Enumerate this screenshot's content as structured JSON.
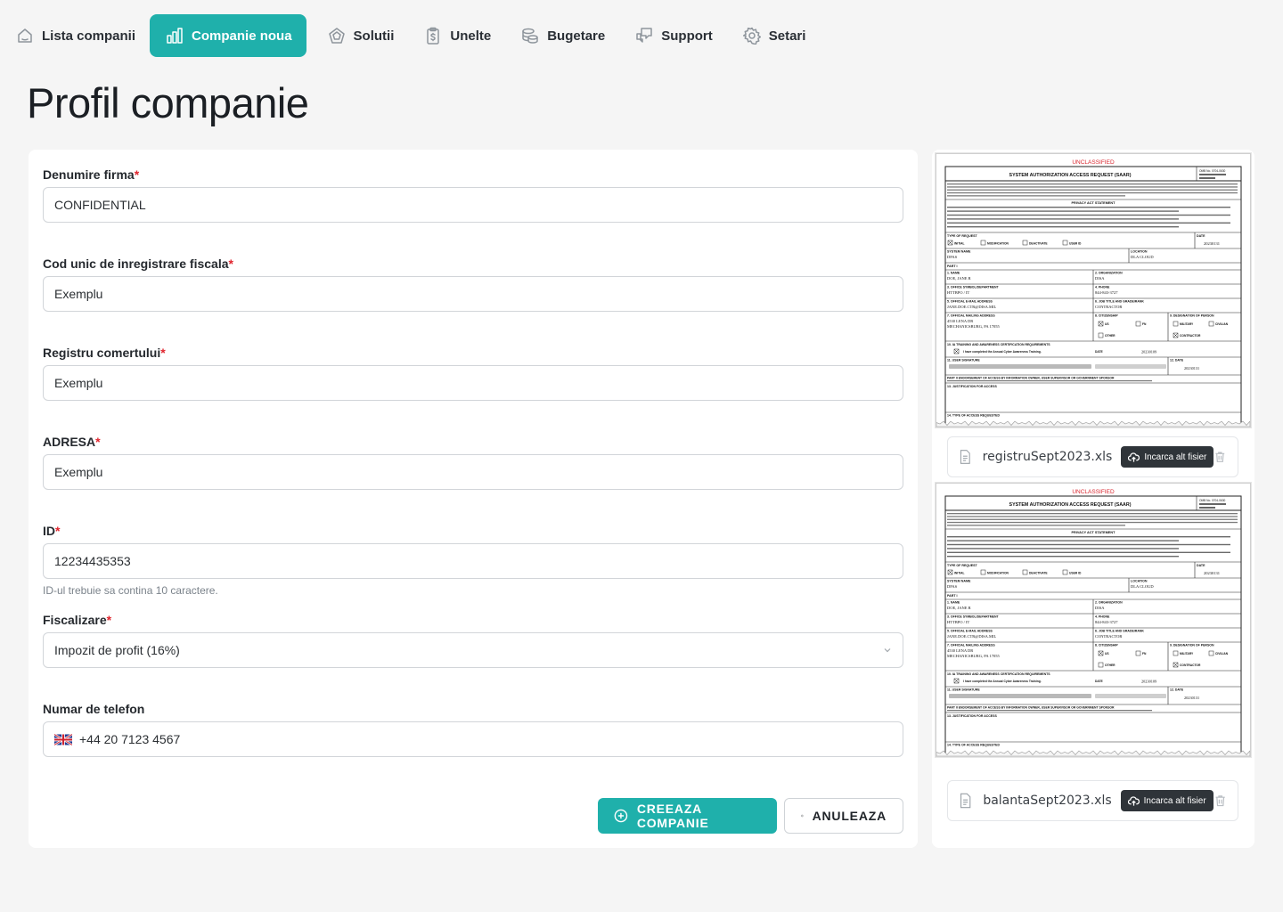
{
  "nav": {
    "items": [
      {
        "label": "Lista companii",
        "icon": "home-icon"
      },
      {
        "label": "Companie noua",
        "icon": "chart-bars-icon",
        "active": true
      },
      {
        "label": "Solutii",
        "icon": "pentagon-icon"
      },
      {
        "label": "Unelte",
        "icon": "clipboard-dollar-icon"
      },
      {
        "label": "Bugetare",
        "icon": "coins-icon"
      },
      {
        "label": "Support",
        "icon": "chat-bubbles-icon"
      },
      {
        "label": "Setari",
        "icon": "gear-icon"
      }
    ]
  },
  "page": {
    "title": "Profil companie"
  },
  "form": {
    "company_name": {
      "label": "Denumire firma",
      "value": "CONFIDENTIAL"
    },
    "fiscal_code": {
      "label": "Cod unic de inregistrare fiscala",
      "value": "Exemplu"
    },
    "trade_register": {
      "label": "Registru comertului",
      "value": "Exemplu"
    },
    "address": {
      "label": "ADRESA",
      "value": "Exemplu"
    },
    "id": {
      "label": "ID",
      "value": "12234435353",
      "hint": "ID-ul trebuie sa contina 10 caractere."
    },
    "taxation": {
      "label": "Fiscalizare",
      "value": "Impozit de profit (16%)"
    },
    "phone": {
      "label": "Numar de telefon",
      "value": "+44 20 7123 4567",
      "flag": "uk-flag-icon"
    },
    "required_mark": "*",
    "create_label": "CREEAZA COMPANIE",
    "cancel_label": "ANULEAZA"
  },
  "documents": [
    {
      "file_name": "registruSept2023.xls",
      "upload_label": "Incarca alt fisier",
      "preview": {
        "banner": "UNCLASSIFIED",
        "title": "SYSTEM AUTHORIZATION ACCESS REQUEST (SAAR)",
        "omb": "OMB No. 0704-0630",
        "privacy": "PRIVACY ACT STATEMENT",
        "type_of_request": "TYPE OF REQUEST",
        "date_label": "DATE",
        "initial": "INITIAL",
        "modification": "MODIFICATION",
        "deactivate": "DEACTIVATE",
        "user_id": "USER ID",
        "date_value": "20230131",
        "system_name": "SYSTEM NAME",
        "system_value": "DPAS",
        "location": "LOCATION",
        "location_value": "DLA CLOUD",
        "part1": "PART I",
        "name_label": "1. NAME",
        "name_value": "DOE, JANE R",
        "org_label": "2. ORGANIZATION",
        "org_value": "DISA",
        "office_label": "3. OFFICE SYMBOL/DEPARTMENT",
        "office_value": "HTTBPO / IT",
        "phone_label": "4. PHONE",
        "phone_value": "844-843-3727",
        "email_label": "5. OFFICIAL E-MAIL ADDRESS",
        "email_value": "JANE.DOE.CTR@DISA.MIL",
        "job_label": "6. JOB TITLE AND GRADE/RANK",
        "job_value": "CONTRACTOR",
        "mail_label": "7. OFFICIAL MAILING ADDRESS",
        "mail_value1": "4530 LENA DR",
        "mail_value2": "MECHANICSBURG, PA 17055",
        "citizenship": "8. CITIZENSHIP",
        "designation": "9. DESIGNATION OF PERSON",
        "us": "US",
        "fn": "FN",
        "other": "OTHER",
        "military": "MILITARY",
        "civilian": "CIVILIAN",
        "contractor": "CONTRACTOR",
        "ia_training": "10. IA TRAINING AND AWARENESS CERTIFICATION REQUIREMENTS",
        "training_check": "I have completed the Annual Cyber Awareness Training.",
        "training_date": "20230109",
        "signature": "11. USER SIGNATURE",
        "sig_date_label": "12. DATE",
        "sig_date": "20230131",
        "part2": "PART II ENDORSEMENT OF ACCESS BY INFORMATION OWNER, USER SUPERVISOR OR GOVERNMENT SPONSOR",
        "justification": "13. JUSTIFICATION FOR ACCESS",
        "type_access": "14. TYPE OF ACCESS REQUESTED"
      }
    },
    {
      "file_name": "balantaSept2023.xls",
      "upload_label": "Incarca alt fisier",
      "preview": {
        "banner": "UNCLASSIFIED",
        "title": "SYSTEM AUTHORIZATION ACCESS REQUEST (SAAR)",
        "omb": "OMB No. 0704-0630",
        "privacy": "PRIVACY ACT STATEMENT",
        "type_of_request": "TYPE OF REQUEST",
        "date_label": "DATE",
        "initial": "INITIAL",
        "modification": "MODIFICATION",
        "deactivate": "DEACTIVATE",
        "user_id": "USER ID",
        "date_value": "20230131",
        "system_name": "SYSTEM NAME",
        "system_value": "DPAS",
        "location": "LOCATION",
        "location_value": "DLA CLOUD",
        "part1": "PART I",
        "name_label": "1. NAME",
        "name_value": "DOE, JANE R",
        "org_label": "2. ORGANIZATION",
        "org_value": "DISA",
        "office_label": "3. OFFICE SYMBOL/DEPARTMENT",
        "office_value": "HTTBPO / IT",
        "phone_label": "4. PHONE",
        "phone_value": "844-843-3727",
        "email_label": "5. OFFICIAL E-MAIL ADDRESS",
        "email_value": "JANE.DOE.CTR@DISA.MIL",
        "job_label": "6. JOB TITLE AND GRADE/RANK",
        "job_value": "CONTRACTOR",
        "mail_label": "7. OFFICIAL MAILING ADDRESS",
        "mail_value1": "4530 LENA DR",
        "mail_value2": "MECHANICSBURG, PA 17055",
        "citizenship": "8. CITIZENSHIP",
        "designation": "9. DESIGNATION OF PERSON",
        "us": "US",
        "fn": "FN",
        "other": "OTHER",
        "military": "MILITARY",
        "civilian": "CIVILIAN",
        "contractor": "CONTRACTOR",
        "ia_training": "10. IA TRAINING AND AWARENESS CERTIFICATION REQUIREMENTS",
        "training_check": "I have completed the Annual Cyber Awareness Training.",
        "training_date": "20230109",
        "signature": "11. USER SIGNATURE",
        "sig_date_label": "12. DATE",
        "sig_date": "20230131",
        "part2": "PART II ENDORSEMENT OF ACCESS BY INFORMATION OWNER, USER SUPERVISOR OR GOVERNMENT SPONSOR",
        "justification": "13. JUSTIFICATION FOR ACCESS",
        "type_access": "14. TYPE OF ACCESS REQUESTED"
      }
    }
  ],
  "colors": {
    "accent": "#1fb0ab",
    "required": "#e0242d",
    "banner": "#d9262e",
    "dark_button": "#2f3439"
  }
}
